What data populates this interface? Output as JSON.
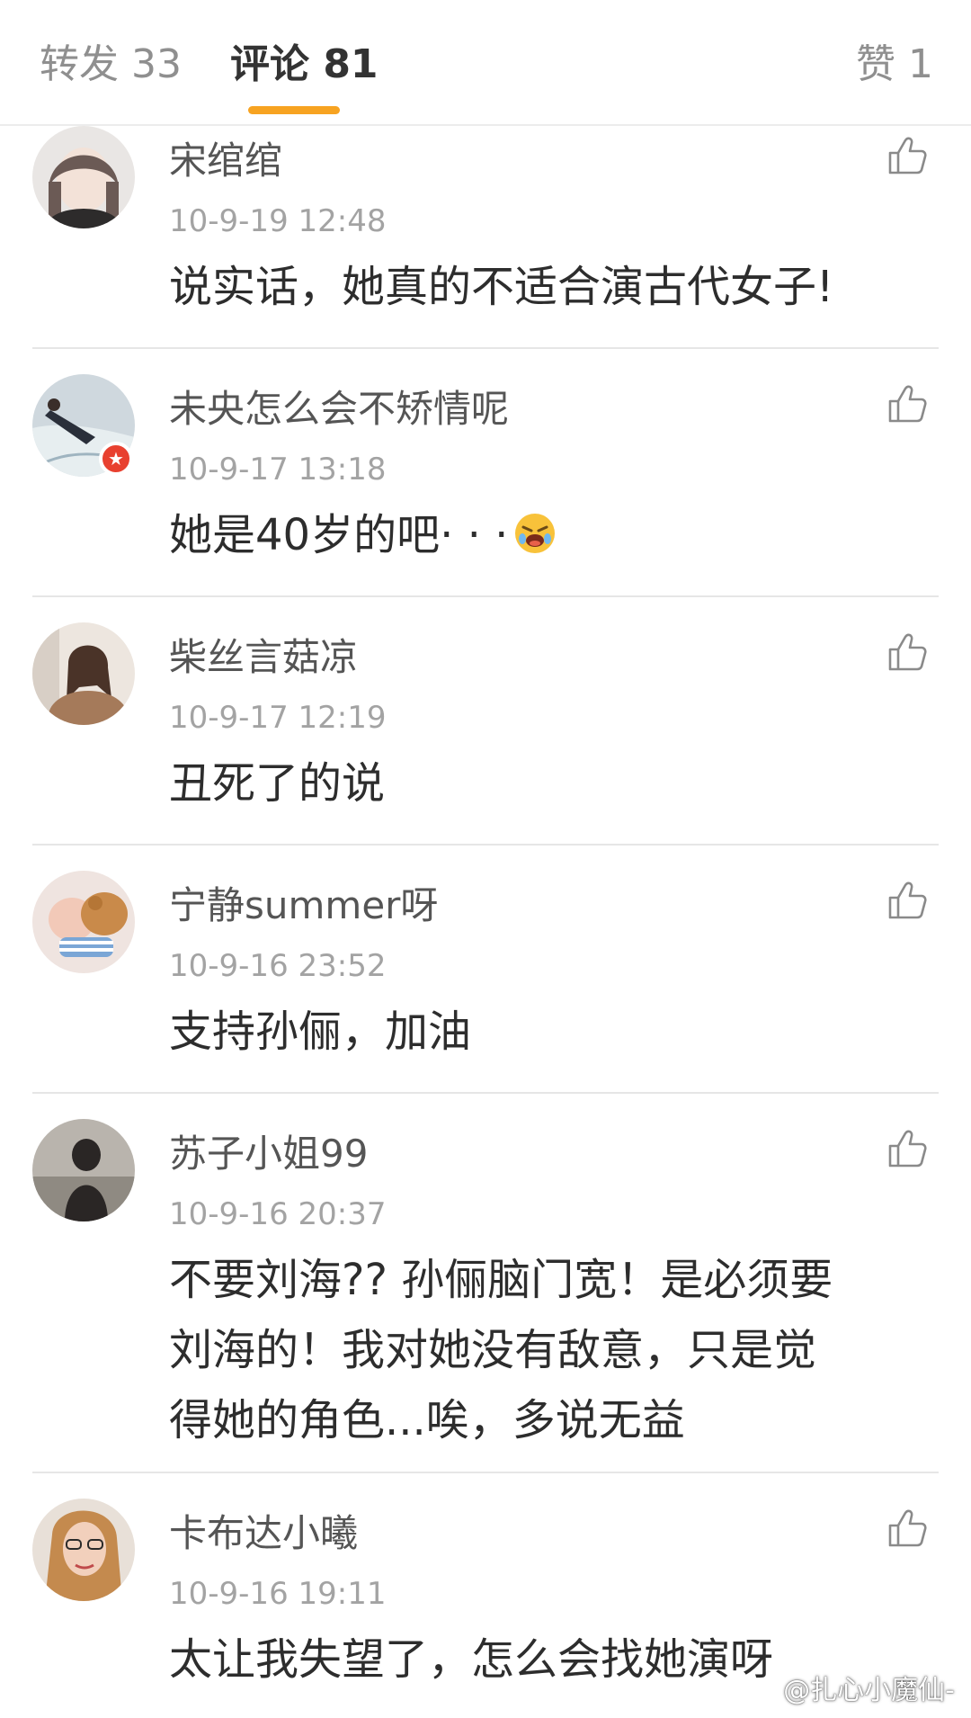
{
  "tabs": {
    "repost_label": "转发 33",
    "comments_label": "评论 81",
    "likes_label": "赞 1",
    "active_color": "#f7a321"
  },
  "comments": [
    {
      "username": "宋绾绾",
      "timestamp": "10-9-19 12:48",
      "lines": [
        "说实话，她真的不适合演古代女子!"
      ],
      "avatar_icon": "avatar-photo",
      "like_icon": "thumbs-up-icon"
    },
    {
      "username": "未央怎么会不矫情呢",
      "timestamp": "10-9-17 13:18",
      "lines": [
        "她是40岁的吧· · ·"
      ],
      "emoji": "crying-face-emoji",
      "verified": true,
      "avatar_icon": "avatar-photo",
      "like_icon": "thumbs-up-icon"
    },
    {
      "username": "柴丝言菇凉",
      "timestamp": "10-9-17 12:19",
      "lines": [
        "丑死了的说"
      ],
      "avatar_icon": "avatar-photo",
      "like_icon": "thumbs-up-icon"
    },
    {
      "username": "宁静summer呀",
      "timestamp": "10-9-16 23:52",
      "lines": [
        "支持孙俪，加油"
      ],
      "avatar_icon": "avatar-photo",
      "like_icon": "thumbs-up-icon"
    },
    {
      "username": "苏子小姐99",
      "timestamp": "10-9-16 20:37",
      "lines": [
        "不要刘海?? 孙俪脑门宽！是必须要",
        "刘海的！我对她没有敌意，只是觉",
        "得她的角色...唉，多说无益"
      ],
      "avatar_icon": "avatar-photo",
      "like_icon": "thumbs-up-icon"
    },
    {
      "username": "卡布达小曦",
      "timestamp": "10-9-16 19:11",
      "lines": [
        "太让我失望了，怎么会找她演呀"
      ],
      "avatar_icon": "avatar-photo",
      "like_icon": "thumbs-up-icon"
    }
  ],
  "watermark": {
    "text": "@扎心小魔仙-",
    "logo_icon": "weibo-logo-icon"
  }
}
